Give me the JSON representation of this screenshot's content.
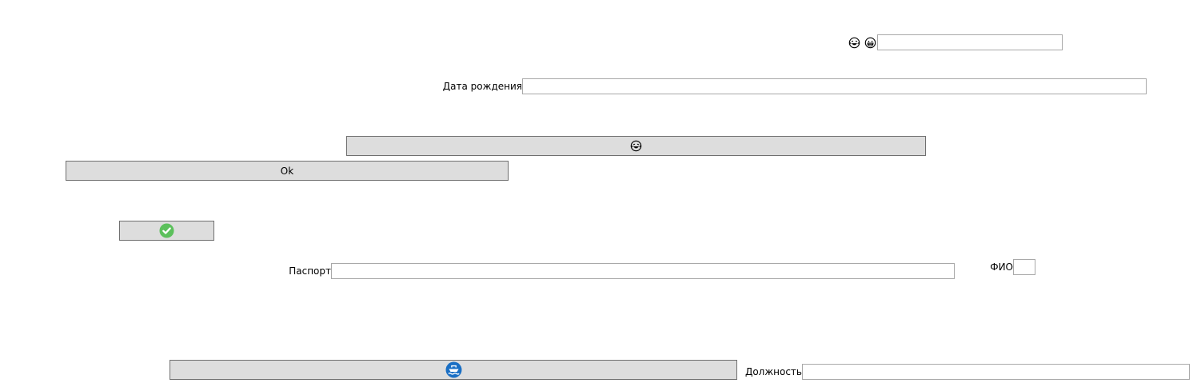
{
  "colors": {
    "button_face": "#dddddd",
    "button_border": "#6f6f6f",
    "field_border": "#a9a9a9",
    "check_green": "#5cc05c",
    "ship_blue": "#1a6fc4"
  },
  "top_row": {
    "icons": [
      "rofl-face-icon",
      "grin-face-icon"
    ],
    "input_value": ""
  },
  "birth_date": {
    "label": "Дата рождения",
    "value": ""
  },
  "emoji_button": {
    "icon": "rofl-face-icon"
  },
  "ok_button": {
    "label": "Ok"
  },
  "check_button": {
    "icon": "check-circle-icon"
  },
  "passport": {
    "label": "Паспорт",
    "value": ""
  },
  "fio": {
    "label": "ФИО",
    "value": ""
  },
  "ship_button": {
    "icon": "ship-icon"
  },
  "position": {
    "label": "Должность",
    "value": ""
  }
}
